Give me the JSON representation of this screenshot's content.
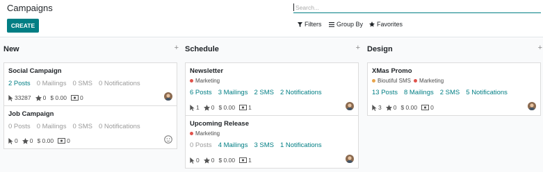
{
  "header": {
    "title": "Campaigns",
    "create_label": "CREATE",
    "search_placeholder": "Search...",
    "filters_label": "Filters",
    "groupby_label": "Group By",
    "favorites_label": "Favorites"
  },
  "colors": {
    "primary": "#017e84",
    "tag_red": "#e0524b",
    "tag_orange": "#e8a44c"
  },
  "columns": [
    {
      "title": "New",
      "add_symbol": "+",
      "cards": [
        {
          "title": "Social Campaign",
          "tags": [],
          "posts": "2 Posts",
          "mailings": "0 Mailings",
          "sms": "0 SMS",
          "notifications": "0 Notifications",
          "clicks": "33287",
          "favorites": "0",
          "revenue": "$ 0.00",
          "documents": "0",
          "avatar": "user-photo"
        },
        {
          "title": "Job Campaign",
          "tags": [],
          "posts": "0 Posts",
          "mailings": "0 Mailings",
          "sms": "0 SMS",
          "notifications": "0 Notifications",
          "clicks": "0",
          "favorites": "0",
          "revenue": "$ 0.00",
          "documents": "0",
          "avatar": "empty-avatar"
        }
      ]
    },
    {
      "title": "Schedule",
      "add_symbol": "+",
      "cards": [
        {
          "title": "Newsletter",
          "tags": [
            "Marketing"
          ],
          "posts": "6 Posts",
          "mailings": "3 Mailings",
          "sms": "2 SMS",
          "notifications": "2 Notifications",
          "clicks": "1",
          "favorites": "0",
          "revenue": "$ 0.00",
          "documents": "1",
          "avatar": "user-photo"
        },
        {
          "title": "Upcoming Release",
          "tags": [
            "Marketing"
          ],
          "posts": "0 Posts",
          "mailings": "4 Mailings",
          "sms": "3 SMS",
          "notifications": "1 Notifications",
          "clicks": "0",
          "favorites": "0",
          "revenue": "$ 0.00",
          "documents": "1",
          "avatar": "user-photo"
        }
      ]
    },
    {
      "title": "Design",
      "add_symbol": "+",
      "cards": [
        {
          "title": "XMas Promo",
          "tags": [
            "Bioutiful SMS",
            "Marketing"
          ],
          "posts": "13 Posts",
          "mailings": "8 Mailings",
          "sms": "2 SMS",
          "notifications": "5 Notifications",
          "clicks": "3",
          "favorites": "0",
          "revenue": "$ 0.00",
          "documents": "0",
          "avatar": "user-photo"
        }
      ]
    }
  ]
}
